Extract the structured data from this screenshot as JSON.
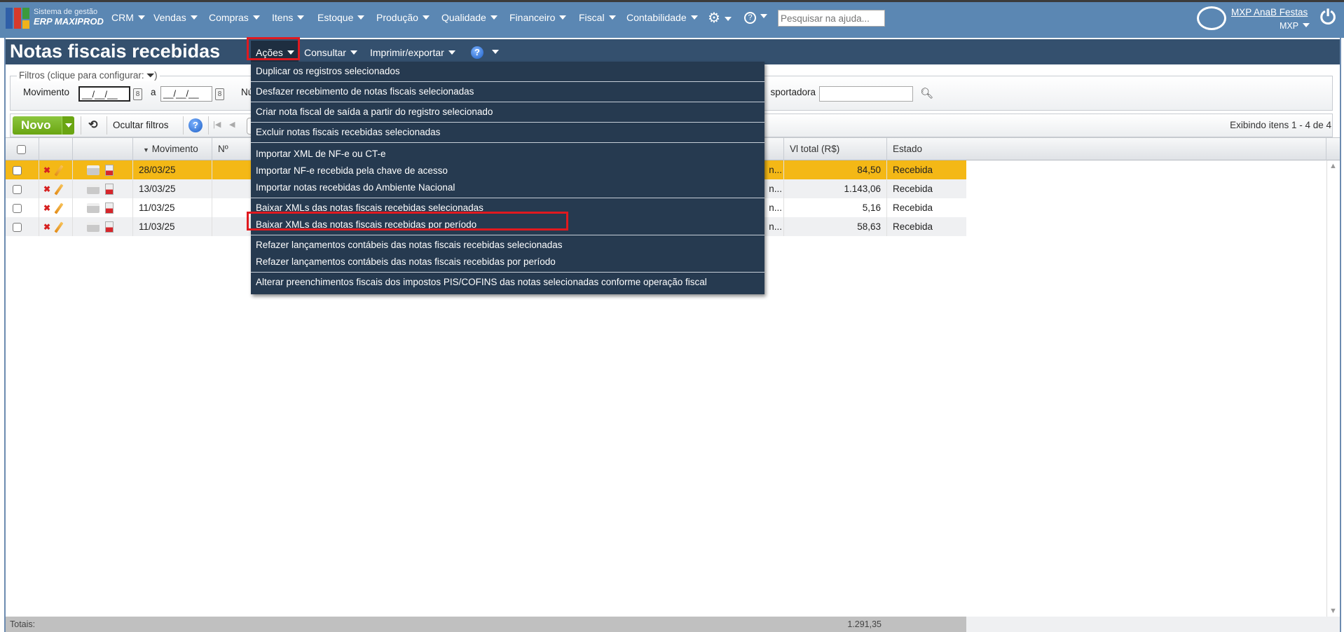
{
  "app": {
    "brand_line1": "Sistema de gestão",
    "brand_line2": "ERP MAXIPROD"
  },
  "nav": [
    "CRM",
    "Vendas",
    "Compras",
    "Itens",
    "Estoque",
    "Produção",
    "Qualidade",
    "Financeiro",
    "Fiscal",
    "Contabilidade"
  ],
  "help_search": {
    "placeholder": "Pesquisar na ajuda..."
  },
  "user": {
    "name": "MXP AnaB Festas",
    "org": "MXP"
  },
  "page": {
    "title": "Notas fiscais recebidas",
    "menus": [
      "Ações",
      "Consultar",
      "Imprimir/exportar"
    ]
  },
  "filters": {
    "legend": "Filtros (clique para configurar:",
    "legend_end": ")",
    "movimento_label": "Movimento",
    "from": "__/__/__",
    "to_label": "a",
    "to": "__/__/__",
    "num_label": "Nú",
    "transp_label": "sportadora",
    "transp_value": ""
  },
  "toolbar": {
    "new": "Novo",
    "hide_filters": "Ocultar filtros",
    "showing": "Exibindo itens 1 - 4 de 4"
  },
  "columns": {
    "movimento": "Movimento",
    "numero": "Nº",
    "vl_total": "Vl total (R$)",
    "estado": "Estado"
  },
  "rows": [
    {
      "movimento": "28/03/25",
      "trunc": "n...",
      "vl_total": "84,50",
      "estado": "Recebida"
    },
    {
      "movimento": "13/03/25",
      "trunc": "n...",
      "vl_total": "1.143,06",
      "estado": "Recebida"
    },
    {
      "movimento": "11/03/25",
      "trunc": "n...",
      "vl_total": "5,16",
      "estado": "Recebida"
    },
    {
      "movimento": "11/03/25",
      "trunc": "n...",
      "vl_total": "58,63",
      "estado": "Recebida"
    }
  ],
  "totals": {
    "label": "Totais:",
    "vl_total": "1.291,35"
  },
  "actions_menu": [
    "Duplicar os registros selecionados",
    "Desfazer recebimento de notas fiscais selecionadas",
    "Criar nota fiscal de saída a partir do registro selecionado",
    "Excluir notas fiscais recebidas selecionadas",
    "Importar XML de NF-e ou CT-e",
    "Importar NF-e recebida pela chave de acesso",
    "Importar notas recebidas do Ambiente Nacional",
    "Baixar XMLs das notas fiscais recebidas selecionadas",
    "Baixar XMLs das notas fiscais recebidas por período",
    "Refazer lançamentos contábeis das notas fiscais recebidas selecionadas",
    "Refazer lançamentos contábeis das notas fiscais recebidas por período",
    "Alterar preenchimentos fiscais dos impostos PIS/COFINS das notas selecionadas conforme operação fiscal"
  ],
  "colors": {
    "nav": "#5b87b3",
    "titlebar": "#34506e",
    "menu": "#263a50",
    "selected_row": "#f4b816",
    "highlight": "#e0191f",
    "new_button": "#7ab52a"
  }
}
